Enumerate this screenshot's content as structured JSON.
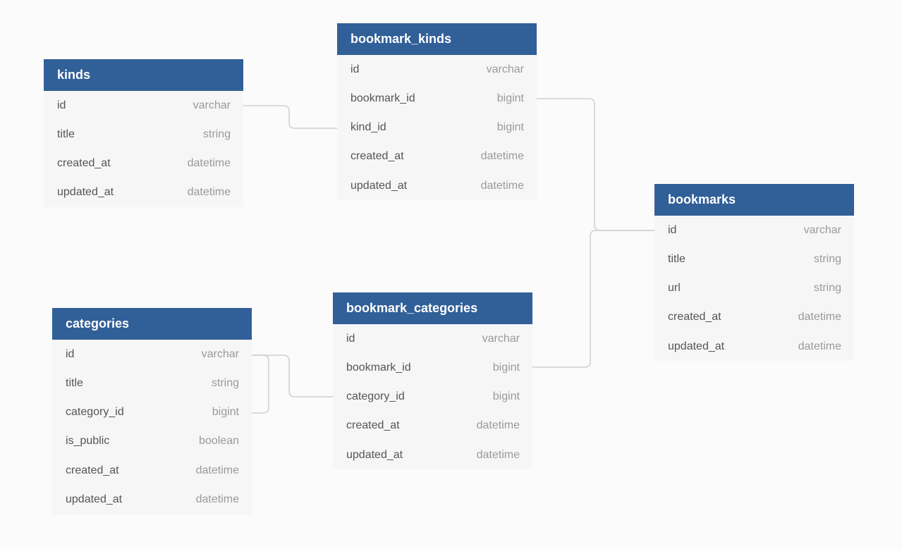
{
  "colors": {
    "header": "#315f98",
    "row": "#f6f6f6",
    "link": "#d0d0d0",
    "background": "#fbfbfb"
  },
  "tables": [
    {
      "id": "kinds",
      "name": "kinds",
      "columns": [
        {
          "name": "id",
          "type": "varchar"
        },
        {
          "name": "title",
          "type": "string"
        },
        {
          "name": "created_at",
          "type": "datetime"
        },
        {
          "name": "updated_at",
          "type": "datetime"
        }
      ]
    },
    {
      "id": "bookmark_kinds",
      "name": "bookmark_kinds",
      "columns": [
        {
          "name": "id",
          "type": "varchar"
        },
        {
          "name": "bookmark_id",
          "type": "bigint"
        },
        {
          "name": "kind_id",
          "type": "bigint"
        },
        {
          "name": "created_at",
          "type": "datetime"
        },
        {
          "name": "updated_at",
          "type": "datetime"
        }
      ]
    },
    {
      "id": "bookmarks",
      "name": "bookmarks",
      "columns": [
        {
          "name": "id",
          "type": "varchar"
        },
        {
          "name": "title",
          "type": "string"
        },
        {
          "name": "url",
          "type": "string"
        },
        {
          "name": "created_at",
          "type": "datetime"
        },
        {
          "name": "updated_at",
          "type": "datetime"
        }
      ]
    },
    {
      "id": "categories",
      "name": "categories",
      "columns": [
        {
          "name": "id",
          "type": "varchar"
        },
        {
          "name": "title",
          "type": "string"
        },
        {
          "name": "category_id",
          "type": "bigint"
        },
        {
          "name": "is_public",
          "type": "boolean"
        },
        {
          "name": "created_at",
          "type": "datetime"
        },
        {
          "name": "updated_at",
          "type": "datetime"
        }
      ]
    },
    {
      "id": "bookmark_categories",
      "name": "bookmark_categories",
      "columns": [
        {
          "name": "id",
          "type": "varchar"
        },
        {
          "name": "bookmark_id",
          "type": "bigint"
        },
        {
          "name": "category_id",
          "type": "bigint"
        },
        {
          "name": "created_at",
          "type": "datetime"
        },
        {
          "name": "updated_at",
          "type": "datetime"
        }
      ]
    }
  ],
  "relations": [
    {
      "from": "kinds.id",
      "to": "bookmark_kinds.kind_id"
    },
    {
      "from": "bookmark_kinds.bookmark_id",
      "to": "bookmarks.id"
    },
    {
      "from": "bookmark_categories.bookmark_id",
      "to": "bookmarks.id"
    },
    {
      "from": "categories.id",
      "to": "bookmark_categories.category_id"
    },
    {
      "from": "categories.id",
      "to": "categories.category_id"
    }
  ]
}
